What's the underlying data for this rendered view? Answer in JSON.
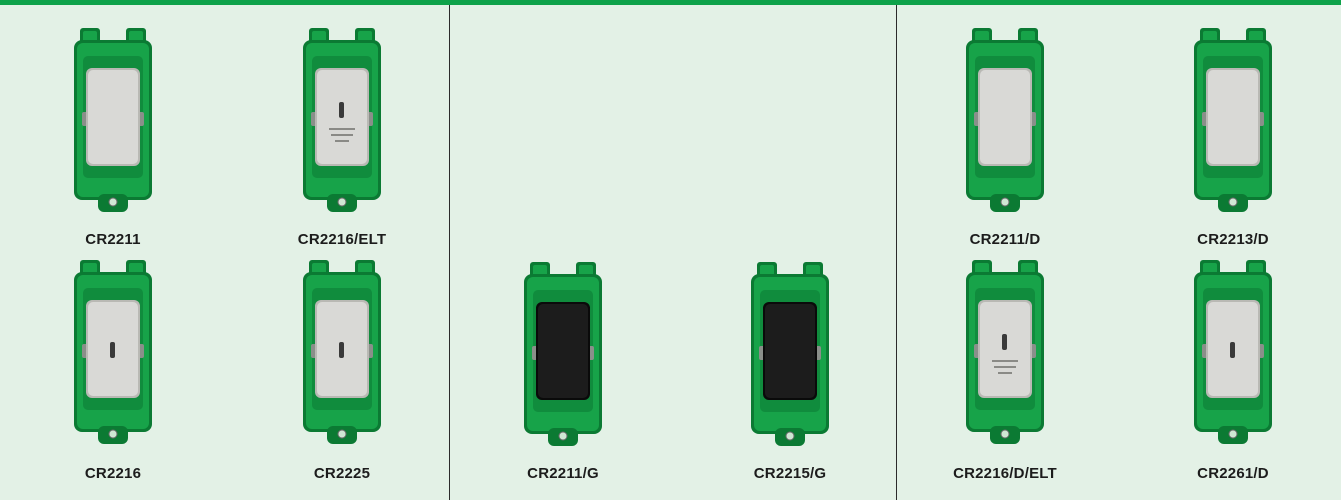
{
  "colors": {
    "background": "#e3f1e6",
    "accent_bar": "#0ea24a",
    "divider": "#2b2b2b",
    "frame_green": "#17a349",
    "frame_green_dark": "#0b7a33",
    "rocker_silver": "#d9d9d6",
    "rocker_black": "#1c1c1c"
  },
  "panels": [
    {
      "products": [
        {
          "code": "CR2211",
          "rocker": "silver",
          "mark": "none"
        },
        {
          "code": "CR2216/ELT",
          "rocker": "silver",
          "mark": "key-elt"
        },
        {
          "code": "CR2216",
          "rocker": "silver",
          "mark": "key"
        },
        {
          "code": "CR2225",
          "rocker": "silver",
          "mark": "key"
        }
      ]
    },
    {
      "products": [
        {
          "code": "CR2211/G",
          "rocker": "black",
          "mark": "none"
        },
        {
          "code": "CR2215/G",
          "rocker": "black",
          "mark": "none"
        }
      ]
    },
    {
      "products": [
        {
          "code": "CR2211/D",
          "rocker": "silver",
          "mark": "none"
        },
        {
          "code": "CR2213/D",
          "rocker": "silver",
          "mark": "none"
        },
        {
          "code": "CR2216/D/ELT",
          "rocker": "silver",
          "mark": "key-elt"
        },
        {
          "code": "CR2261/D",
          "rocker": "silver",
          "mark": "key"
        }
      ]
    }
  ]
}
